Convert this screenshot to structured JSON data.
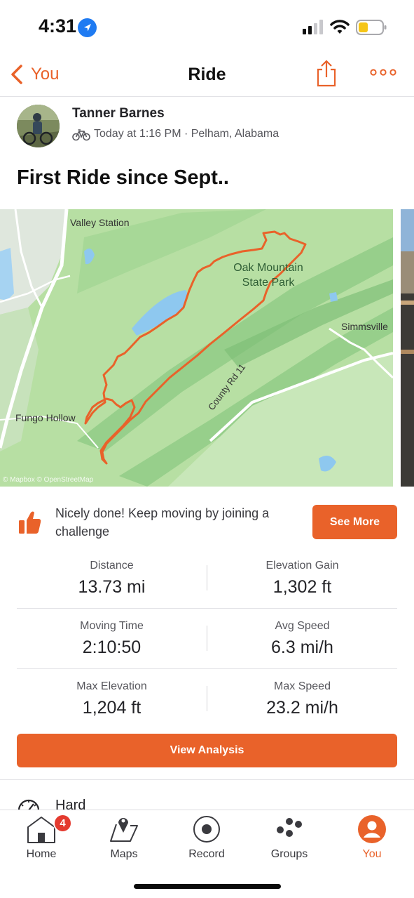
{
  "status_bar": {
    "time": "4:31"
  },
  "nav": {
    "back_label": "You",
    "title": "Ride"
  },
  "athlete": {
    "name": "Tanner Barnes",
    "meta": "Today at 1:16 PM · Pelham, Alabama"
  },
  "activity": {
    "title": "First Ride since Sept.."
  },
  "map": {
    "labels": {
      "valley_station": "Valley Station",
      "oak_mountain_line1": "Oak Mountain",
      "oak_mountain_line2": "State Park",
      "simmsville": "Simmsville",
      "fungo_hollow": "Fungo Hollow",
      "county_rd": "County Rd 11",
      "attribution": "© Mapbox © OpenStreetMap"
    },
    "colors": {
      "route": "#e9622a",
      "land": "#b7dfa3",
      "water": "#8ec8ef",
      "roads": "#ffffff"
    }
  },
  "challenge": {
    "text": "Nicely done! Keep moving by joining a challenge",
    "button_label": "See More"
  },
  "stats": [
    [
      {
        "label": "Distance",
        "value": "13.73 mi"
      },
      {
        "label": "Elevation Gain",
        "value": "1,302 ft"
      }
    ],
    [
      {
        "label": "Moving Time",
        "value": "2:10:50"
      },
      {
        "label": "Avg Speed",
        "value": "6.3 mi/h"
      }
    ],
    [
      {
        "label": "Max Elevation",
        "value": "1,204 ft"
      },
      {
        "label": "Max Speed",
        "value": "23.2 mi/h"
      }
    ]
  ],
  "analysis_button": "View Analysis",
  "effort": {
    "label": "Hard"
  },
  "tabs": [
    {
      "label": "Home",
      "icon": "home-icon",
      "badge": "4"
    },
    {
      "label": "Maps",
      "icon": "maps-icon"
    },
    {
      "label": "Record",
      "icon": "record-icon"
    },
    {
      "label": "Groups",
      "icon": "groups-icon"
    },
    {
      "label": "You",
      "icon": "you-icon",
      "active": true
    }
  ],
  "colors": {
    "accent": "#e9622a",
    "badge": "#e43a2f"
  }
}
